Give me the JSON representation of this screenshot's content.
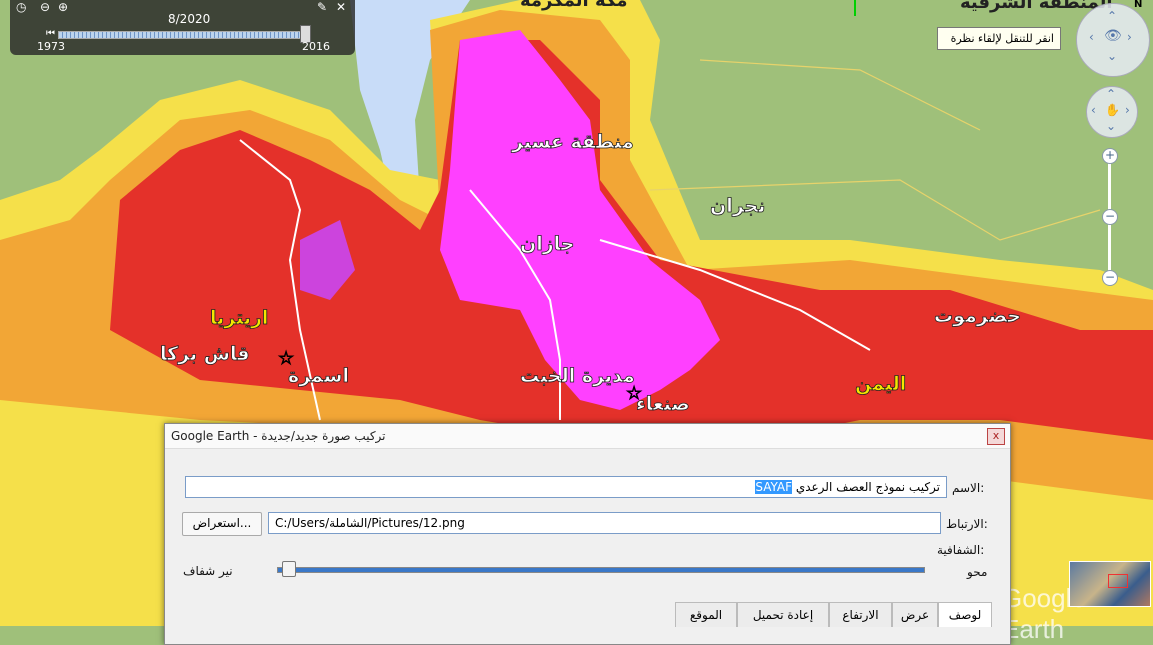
{
  "map": {
    "labels": {
      "top_left_partial": "مكة المكرمة",
      "top_right_partial": "المنطقة الشرقية",
      "asir": "منطقة عسير",
      "najran": "نجران",
      "jazan": "جازان",
      "eritrea": "اريتريا",
      "gash_barka": "قاش بركا",
      "asmara": "اسمرة",
      "khabt": "مديرة الخبت",
      "sanaa": "صنعاء",
      "hadramaut": "حضرموت",
      "yemen": "اليمن"
    },
    "colors": {
      "yellow": "#f5e04a",
      "orange": "#f2a636",
      "red": "#e4312a",
      "magenta": "#ff40ff",
      "water": "#c8dcf8",
      "land": "#9fc07a"
    }
  },
  "time_slider": {
    "date": "8/2020",
    "start_year": "1973",
    "end_year": "2016"
  },
  "navigation": {
    "tooltip": "انقر للتنقل لإلقاء نظرة",
    "north_label": "N",
    "zoom_in": "+",
    "zoom_out": "−"
  },
  "brand": "Google Earth",
  "dialog": {
    "title": "Google Earth - تركيب صورة جديد/جديدة",
    "close": "x",
    "name_label": "الاسم:",
    "name_value": "تركيب نموذج العصف الرعدي",
    "name_selected": "SAYAF",
    "link_label": "الارتباط:",
    "link_value": "C:/Users/الشاملة/Pictures/12.png",
    "browse_button": "استعراض...",
    "opacity_label": "الشفافية:",
    "opacity_left": "محو",
    "opacity_right": "نير شفاف",
    "opacity_value": 0.02,
    "tabs": [
      "لوصف",
      "عرض",
      "الارتفاع",
      "إعادة تحميل",
      "الموقع"
    ]
  }
}
